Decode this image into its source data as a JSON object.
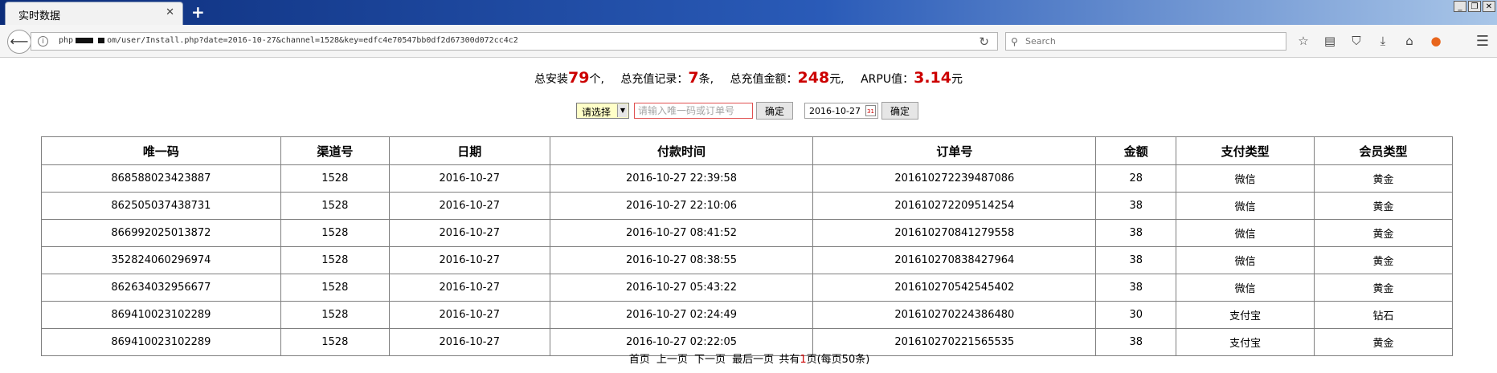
{
  "browser": {
    "tab_title": "实时数据",
    "tab_close": "✕",
    "new_tab": "+",
    "window_controls": [
      "_",
      "❐",
      "✕"
    ],
    "url_prefix": "php",
    "url_rest": "om/user/Install.php?date=2016-10-27&channel=1528&key=edfc4e70547bb0df2d67300d072cc4c2",
    "search_placeholder": "Search",
    "icons": [
      "star-icon",
      "reader-icon",
      "pocket-icon",
      "download-icon",
      "home-icon",
      "firefox-icon",
      "menu-icon"
    ]
  },
  "summary": {
    "installs_label": "总安装",
    "installs_value": "79",
    "installs_unit": "个,",
    "recharge_label": "总充值记录：",
    "recharge_value": "7",
    "recharge_unit": "条,",
    "amount_label": "总充值金额：",
    "amount_value": "248",
    "amount_unit": "元,",
    "arpu_label": "ARPU值：",
    "arpu_value": "3.14",
    "arpu_unit": "元"
  },
  "filters": {
    "select_value": "请选择",
    "search_placeholder": "请输入唯一码或订单号",
    "confirm_label": "确定",
    "date_value": "2016-10-27",
    "date_confirm_label": "确定"
  },
  "table": {
    "headers": [
      "唯一码",
      "渠道号",
      "日期",
      "付款时间",
      "订单号",
      "金额",
      "支付类型",
      "会员类型"
    ],
    "rows": [
      [
        "868588023423887",
        "1528",
        "2016-10-27",
        "2016-10-27 22:39:58",
        "201610272239487086",
        "28",
        "微信",
        "黄金"
      ],
      [
        "862505037438731",
        "1528",
        "2016-10-27",
        "2016-10-27 22:10:06",
        "201610272209514254",
        "38",
        "微信",
        "黄金"
      ],
      [
        "866992025013872",
        "1528",
        "2016-10-27",
        "2016-10-27 08:41:52",
        "201610270841279558",
        "38",
        "微信",
        "黄金"
      ],
      [
        "352824060296974",
        "1528",
        "2016-10-27",
        "2016-10-27 08:38:55",
        "201610270838427964",
        "38",
        "微信",
        "黄金"
      ],
      [
        "862634032956677",
        "1528",
        "2016-10-27",
        "2016-10-27 05:43:22",
        "201610270542545402",
        "38",
        "微信",
        "黄金"
      ],
      [
        "869410023102289",
        "1528",
        "2016-10-27",
        "2016-10-27 02:24:49",
        "201610270224386480",
        "30",
        "支付宝",
        "钻石"
      ],
      [
        "869410023102289",
        "1528",
        "2016-10-27",
        "2016-10-27 02:22:05",
        "201610270221565535",
        "38",
        "支付宝",
        "黄金"
      ]
    ]
  },
  "pager": {
    "first": "首页",
    "prev": "上一页",
    "next": "下一页",
    "last": "最后一页",
    "total_prefix": "共有",
    "total_pages": "1",
    "total_suffix": "页(每页50条)"
  }
}
